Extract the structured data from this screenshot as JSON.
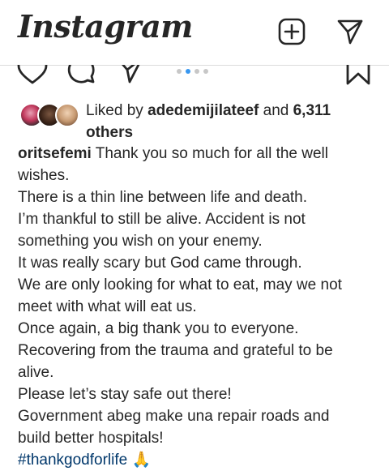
{
  "app": {
    "title": "Instagram"
  },
  "post": {
    "carousel": {
      "count": 4,
      "active_index": 1
    },
    "likes": {
      "prefix": "Liked by",
      "user": "adedemijilateef",
      "conjunction": "and",
      "others_line1": "6,311",
      "others_line2": "others"
    },
    "caption": {
      "username": "oritsefemi",
      "lines": [
        " Thank you so much for all the well",
        "wishes.",
        "There is a thin line between life and death.",
        "I’m thankful to still be alive. Accident is not",
        "something you wish on your enemy.",
        "It was really scary but God came through.",
        "We are only looking for what to eat, may we not",
        "meet with what will eat us.",
        "Once again, a big thank you to everyone.",
        "Recovering from the trauma and grateful to be",
        "alive.",
        "Please let’s stay safe out there!",
        "Government abeg make una repair roads and",
        "build better hospitals!"
      ],
      "hashtag": "#thankgodforlife",
      "emoji": "🙏"
    }
  },
  "icons": {
    "new_post": "plus-square-icon",
    "direct": "paper-plane-icon",
    "like": "heart-icon",
    "comment": "comment-icon",
    "share": "share-icon",
    "save": "bookmark-icon"
  },
  "colors": {
    "text": "#262626",
    "accent_dot": "#3897f0",
    "hashtag": "#00376b"
  }
}
